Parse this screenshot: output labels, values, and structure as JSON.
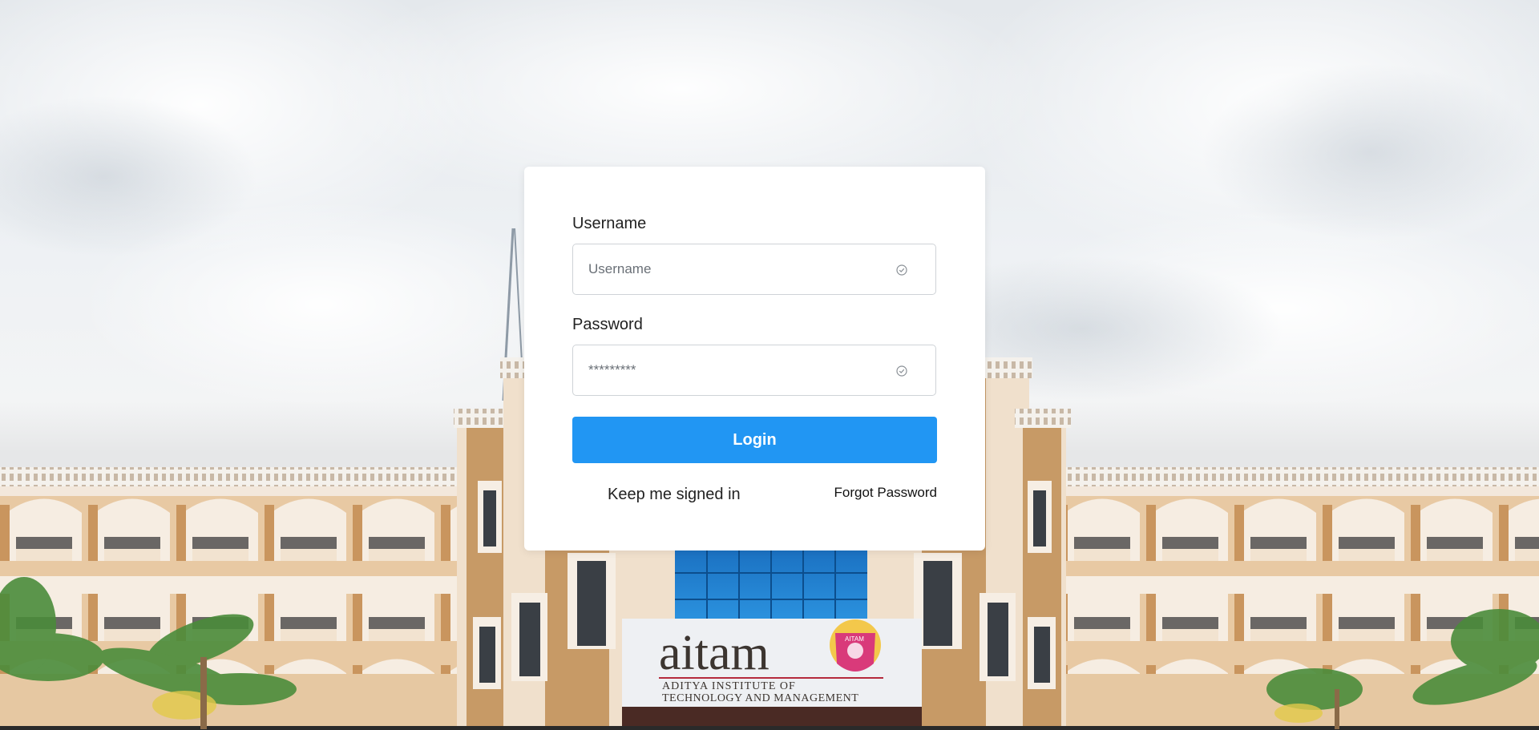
{
  "login_form": {
    "username_label": "Username",
    "username_placeholder": "Username",
    "password_label": "Password",
    "password_placeholder": "*********",
    "login_button": "Login",
    "keep_signed_in": "Keep me signed in",
    "forgot_password": "Forgot Password"
  },
  "background": {
    "logo_text": "aitam",
    "institute_line1": "ADITYA INSTITUTE OF",
    "institute_line2": "TECHNOLOGY AND MANAGEMENT",
    "emblem_text": "AITAM"
  },
  "colors": {
    "primary": "#2196f3",
    "card": "#ffffff",
    "building_tan": "#c49a6c",
    "building_cream": "#f1e4d6"
  },
  "icons": {
    "username_field_icon": "check-circle-icon",
    "password_field_icon": "check-circle-icon"
  }
}
